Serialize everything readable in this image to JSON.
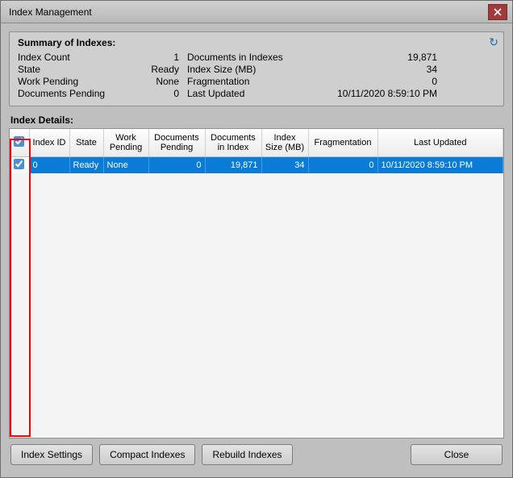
{
  "window": {
    "title": "Index Management"
  },
  "summary": {
    "heading": "Summary of Indexes:",
    "rows": {
      "index_count_label": "Index Count",
      "index_count_value": "1",
      "docs_in_indexes_label": "Documents in Indexes",
      "docs_in_indexes_value": "19,871",
      "state_label": "State",
      "state_value": "Ready",
      "index_size_label": "Index Size (MB)",
      "index_size_value": "34",
      "work_pending_label": "Work Pending",
      "work_pending_value": "None",
      "fragmentation_label": "Fragmentation",
      "fragmentation_value": "0",
      "docs_pending_label": "Documents Pending",
      "docs_pending_value": "0",
      "last_updated_label": "Last Updated",
      "last_updated_value": "10/11/2020 8:59:10 PM"
    }
  },
  "details": {
    "heading": "Index Details:",
    "headers": {
      "index_id": "Index ID",
      "state": "State",
      "work_pending": "Work Pending",
      "docs_pending": "Documents Pending",
      "docs_in_index": "Documents in Index",
      "index_size": "Index Size (MB)",
      "fragmentation": "Fragmentation",
      "last_updated": "Last Updated"
    },
    "row": {
      "checked": true,
      "index_id": "0",
      "state": "Ready",
      "work_pending": "None",
      "docs_pending": "0",
      "docs_in_index": "19,871",
      "index_size": "34",
      "fragmentation": "0",
      "last_updated": "10/11/2020 8:59:10 PM"
    }
  },
  "buttons": {
    "index_settings": "Index Settings",
    "compact": "Compact Indexes",
    "rebuild": "Rebuild Indexes",
    "close": "Close"
  }
}
